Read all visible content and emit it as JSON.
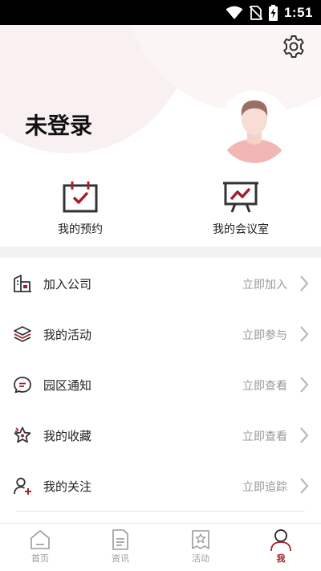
{
  "status_bar": {
    "time": "1:51"
  },
  "profile": {
    "username": "未登录"
  },
  "quick_entries": [
    {
      "label": "我的预约",
      "icon": "calendar-check-icon"
    },
    {
      "label": "我的会议室",
      "icon": "presentation-board-icon"
    }
  ],
  "menu": [
    {
      "label": "加入公司",
      "action": "立即加入",
      "icon": "building-icon"
    },
    {
      "label": "我的活动",
      "action": "立即参与",
      "icon": "layers-icon"
    },
    {
      "label": "园区通知",
      "action": "立即查看",
      "icon": "message-icon"
    },
    {
      "label": "我的收藏",
      "action": "立即查看",
      "icon": "star-icon"
    },
    {
      "label": "我的关注",
      "action": "立即追踪",
      "icon": "user-add-icon"
    }
  ],
  "tabs": [
    {
      "label": "首页",
      "icon": "home-icon",
      "active": false
    },
    {
      "label": "资讯",
      "icon": "document-icon",
      "active": false
    },
    {
      "label": "活动",
      "icon": "event-icon",
      "active": false
    },
    {
      "label": "我",
      "icon": "user-icon",
      "active": true
    }
  ],
  "colors": {
    "accent": "#a3212b",
    "icon_dark": "#333333",
    "muted": "#999999",
    "divider": "#f2f2f4"
  }
}
